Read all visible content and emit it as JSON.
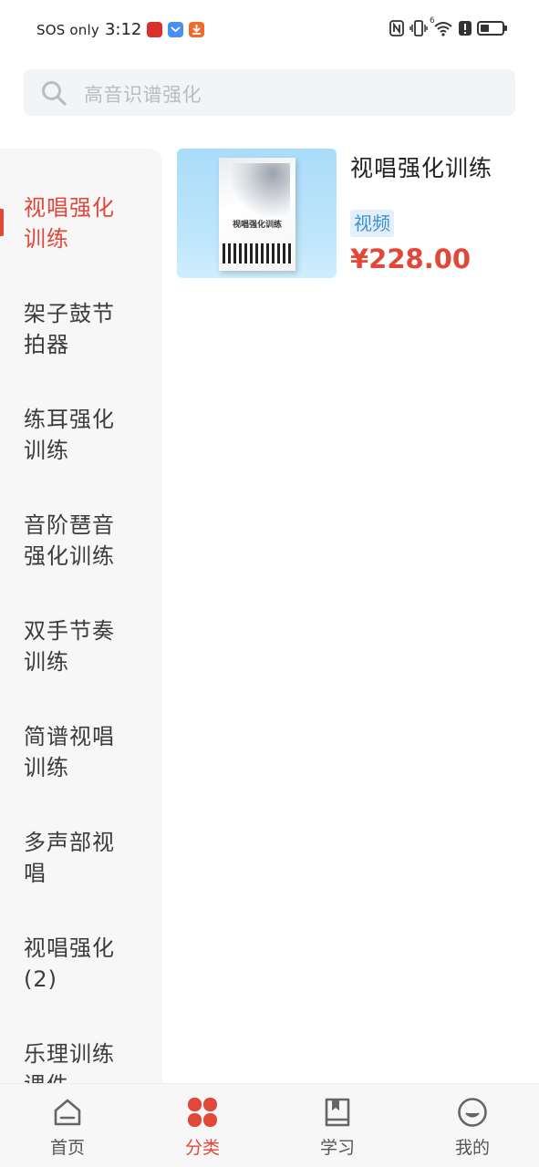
{
  "status_bar": {
    "carrier": "SOS only",
    "time": "3:12",
    "app_icons": [
      "red-app-icon",
      "blue-app-icon",
      "download-app-icon"
    ],
    "right_icons": [
      "nfc-icon",
      "vibrate-icon",
      "wifi-icon",
      "alert-icon",
      "battery-icon"
    ],
    "wifi_badge": "6"
  },
  "search": {
    "placeholder": "高音识谱强化"
  },
  "categories": [
    {
      "line1": "视唱强化",
      "line2": "训练",
      "active": true
    },
    {
      "line1": "架子鼓节",
      "line2": "拍器",
      "active": false
    },
    {
      "line1": "练耳强化",
      "line2": "训练",
      "active": false
    },
    {
      "line1": "音阶琶音",
      "line2": "强化训练",
      "active": false
    },
    {
      "line1": "双手节奏",
      "line2": "训练",
      "active": false
    },
    {
      "line1": "简谱视唱",
      "line2": "训练",
      "active": false
    },
    {
      "line1": "多声部视",
      "line2": "唱",
      "active": false
    },
    {
      "line1": "视唱强化",
      "line2": "(2)",
      "active": false
    },
    {
      "line1": "乐理训练",
      "line2": "课件",
      "active": false
    }
  ],
  "products": [
    {
      "title": "视唱强化训练",
      "cover_text": "视唱强化训练",
      "tag": "视频",
      "price": "¥228.00"
    }
  ],
  "tabs": [
    {
      "label": "首页",
      "icon": "home-icon",
      "active": false
    },
    {
      "label": "分类",
      "icon": "category-icon",
      "active": true
    },
    {
      "label": "学习",
      "icon": "book-icon",
      "active": false
    },
    {
      "label": "我的",
      "icon": "profile-icon",
      "active": false
    }
  ],
  "colors": {
    "accent": "#e2483a",
    "tag_text": "#3e8fd6",
    "tag_bg": "#e3f0fb",
    "sidebar_bg": "#f7f7f7"
  }
}
